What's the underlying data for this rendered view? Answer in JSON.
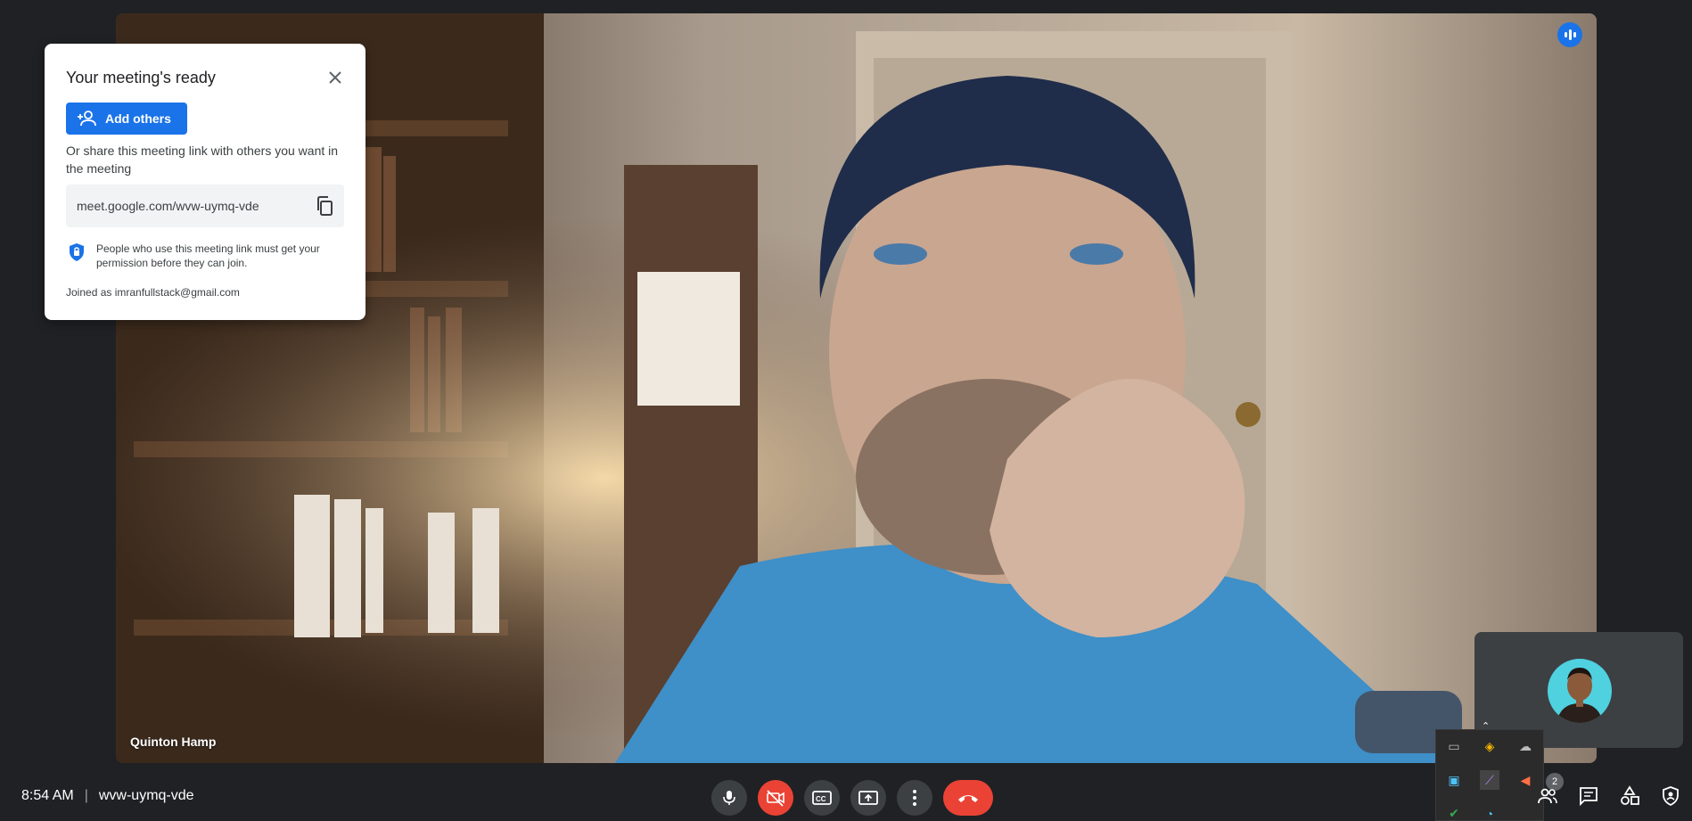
{
  "dialog": {
    "title": "Your meeting's ready",
    "add_others_label": "Add others",
    "share_text": "Or share this meeting link with others you want in the meeting",
    "meeting_link": "meet.google.com/wvw-uymq-vde",
    "permission_text": "People who use this meeting link must get your permission before they can join.",
    "joined_as": "Joined as imranfullstack@gmail.com"
  },
  "main_video": {
    "participant_name": "Quinton Hamp"
  },
  "bottom_bar": {
    "time": "8:54 AM",
    "separator": "|",
    "meeting_code": "wvw-uymq-vde",
    "people_count": "2"
  },
  "colors": {
    "accent": "#1a73e8",
    "danger": "#ea4335",
    "background": "#202124",
    "control": "#3c4043"
  },
  "icons": {
    "speaking": "audio-level-icon",
    "close": "close-icon",
    "add_person": "person-add-icon",
    "copy": "copy-icon",
    "shield": "shield-icon",
    "mic": "mic-icon",
    "camera_off": "videocam-off-icon",
    "captions": "closed-caption-icon",
    "present": "present-screen-icon",
    "more": "more-vert-icon",
    "end_call": "call-end-icon",
    "people": "people-icon",
    "chat": "chat-icon",
    "activities": "activities-icon",
    "host_controls": "host-controls-icon"
  }
}
